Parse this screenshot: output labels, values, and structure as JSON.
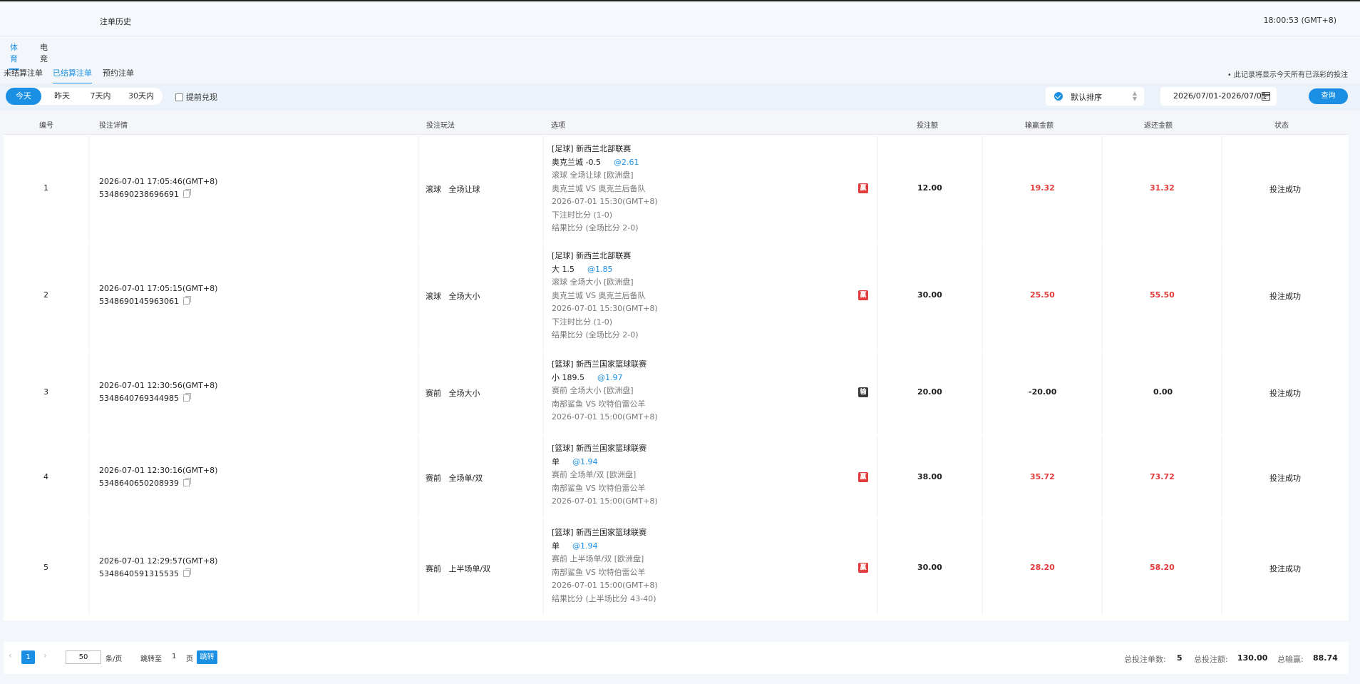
{
  "header": {
    "title": "注单历史",
    "clock": "18:00:53 (GMT+8)"
  },
  "tabs": [
    {
      "label": "体育",
      "active": true
    },
    {
      "label": "电竞",
      "active": false
    }
  ],
  "subtabs": [
    {
      "label": "未结算注单",
      "active": false
    },
    {
      "label": "已结算注单",
      "active": true
    },
    {
      "label": "预约注单",
      "active": false
    }
  ],
  "note": "• 此记录将显示今天所有已派彩的投注",
  "filters": {
    "ranges": [
      {
        "label": "今天",
        "active": true
      },
      {
        "label": "昨天",
        "active": false
      },
      {
        "label": "7天内",
        "active": false
      },
      {
        "label": "30天内",
        "active": false
      }
    ],
    "early_cashout": "提前兑现",
    "sort_label": "默认排序",
    "date_range": "2026/07/01-2026/07/01",
    "query": "查询"
  },
  "columns": [
    "编号",
    "投注详情",
    "投注玩法",
    "选项",
    "投注额",
    "输赢金额",
    "返还金额",
    "状态"
  ],
  "rows": [
    {
      "no": "1",
      "time": "2026-07-01 17:05:46(GMT+8)",
      "order_id": "5348690238696691",
      "play_type": "滚球",
      "play_name": "全场让球",
      "league": "[足球] 新西兰北部联赛",
      "pick": "奥克兰城 -0.5",
      "odds": "@2.61",
      "info": [
        "滚球 全场让球 [欧洲盘]",
        "奥克兰城 VS 奥克兰后备队",
        "2026-07-01 15:30(GMT+8)",
        "下注时比分 (1-0)",
        "结果比分 (全场比分 2-0)"
      ],
      "result_badge": "赢",
      "stake": "12.00",
      "win_loss": "19.32",
      "return": "31.32",
      "status": "投注成功"
    },
    {
      "no": "2",
      "time": "2026-07-01 17:05:15(GMT+8)",
      "order_id": "5348690145963061",
      "play_type": "滚球",
      "play_name": "全场大小",
      "league": "[足球] 新西兰北部联赛",
      "pick": "大 1.5",
      "odds": "@1.85",
      "info": [
        "滚球 全场大小 [欧洲盘]",
        "奥克兰城 VS 奥克兰后备队",
        "2026-07-01 15:30(GMT+8)",
        "下注时比分 (1-0)",
        "结果比分 (全场比分 2-0)"
      ],
      "result_badge": "赢",
      "stake": "30.00",
      "win_loss": "25.50",
      "return": "55.50",
      "status": "投注成功"
    },
    {
      "no": "3",
      "time": "2026-07-01 12:30:56(GMT+8)",
      "order_id": "5348640769344985",
      "play_type": "赛前",
      "play_name": "全场大小",
      "league": "[篮球] 新西兰国家篮球联赛",
      "pick": "小 189.5",
      "odds": "@1.97",
      "info": [
        "赛前 全场大小 [欧洲盘]",
        "南部鲨鱼 VS 坎特伯雷公羊",
        "2026-07-01 15:00(GMT+8)"
      ],
      "result_badge": "输",
      "stake": "20.00",
      "win_loss": "-20.00",
      "return": "0.00",
      "status": "投注成功"
    },
    {
      "no": "4",
      "time": "2026-07-01 12:30:16(GMT+8)",
      "order_id": "5348640650208939",
      "play_type": "赛前",
      "play_name": "全场单/双",
      "league": "[篮球] 新西兰国家篮球联赛",
      "pick": "单",
      "odds": "@1.94",
      "info": [
        "赛前 全场单/双 [欧洲盘]",
        "南部鲨鱼 VS 坎特伯雷公羊",
        "2026-07-01 15:00(GMT+8)"
      ],
      "result_badge": "赢",
      "stake": "38.00",
      "win_loss": "35.72",
      "return": "73.72",
      "status": "投注成功"
    },
    {
      "no": "5",
      "time": "2026-07-01 12:29:57(GMT+8)",
      "order_id": "5348640591315535",
      "play_type": "赛前",
      "play_name": "上半场单/双",
      "league": "[篮球] 新西兰国家篮球联赛",
      "pick": "单",
      "odds": "@1.94",
      "info": [
        "赛前 上半场单/双 [欧洲盘]",
        "南部鲨鱼 VS 坎特伯雷公羊",
        "2026-07-01 15:00(GMT+8)",
        "结果比分 (上半场比分 43-40)"
      ],
      "result_badge": "赢",
      "stake": "30.00",
      "win_loss": "28.20",
      "return": "58.20",
      "status": "投注成功"
    }
  ],
  "pagination": {
    "current_page": "1",
    "page_size": "50",
    "per_page_label": "条/页",
    "jump_label": "跳转至",
    "jump_page": "1",
    "page_unit": "页",
    "go_label": "跳转"
  },
  "summary": {
    "count_label": "总投注单数:",
    "count": "5",
    "stake_label": "总投注额:",
    "stake": "130.00",
    "win_label": "总输赢:",
    "win": "88.74"
  },
  "colors": {
    "accent": "#1a8fe3",
    "win": "#e23b3b",
    "lose_badge": "#3a3a3a"
  }
}
